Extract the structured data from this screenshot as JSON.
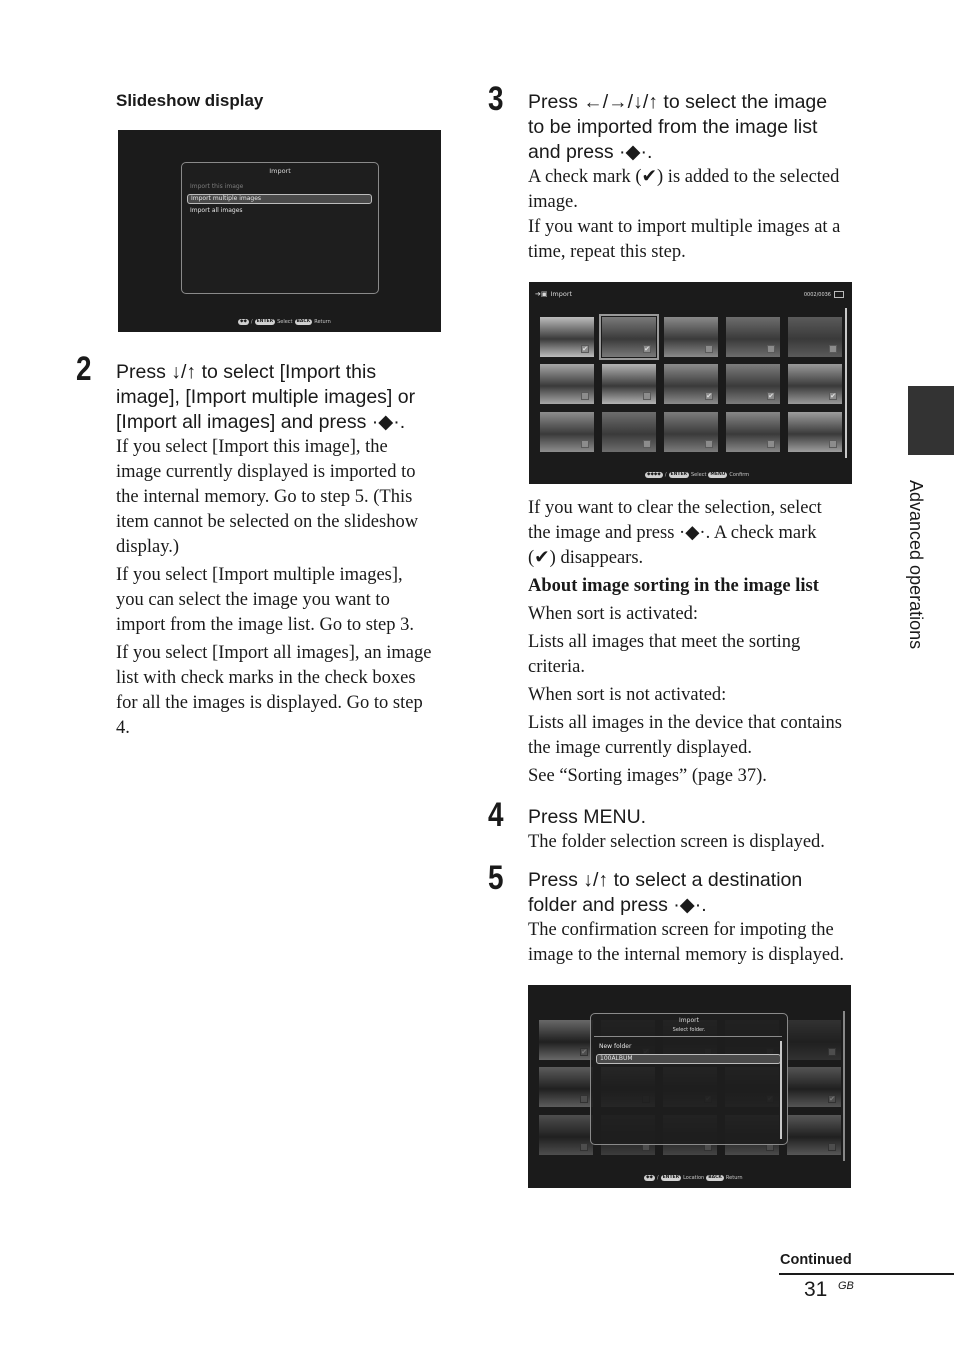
{
  "page": {
    "section_tab": "Advanced operations",
    "continued": "Continued",
    "page_number": "31",
    "page_suffix": "GB"
  },
  "left": {
    "slideshow_title": "Slideshow display",
    "screen1": {
      "title": "Import",
      "items": [
        {
          "label": "Import this image",
          "state": "disabled"
        },
        {
          "label": "Import multiple images",
          "state": "selected"
        },
        {
          "label": "Import all images",
          "state": "normal"
        }
      ],
      "footer": {
        "nav_icon": "up-down-icon",
        "sep": "/",
        "enter_key": "ENTER",
        "enter_action": "Select",
        "back_key": "BACK",
        "back_action": "Return"
      }
    },
    "step2": {
      "number": "2",
      "heading_lines": [
        "Press ↓/↑ to select [Import this",
        "image], [Import multiple images] or",
        "[Import all images] and press ·◆·."
      ],
      "paragraphs": [
        [
          "If you select [Import this image], the",
          "image currently displayed is imported to",
          "the internal memory. Go to step 5. (This",
          "item cannot be selected on the slideshow",
          "display.)"
        ],
        [
          "If you select [Import multiple images],",
          "you can select the image you want to",
          "import from the image list. Go to step 3."
        ],
        [
          "If you select [Import all images], an image",
          "list with check marks in the check boxes",
          "for all the images is displayed. Go to step",
          "4."
        ]
      ]
    }
  },
  "right": {
    "step3": {
      "number": "3",
      "heading_lines": [
        "Press ←/→/↓/↑ to select the image",
        "to be imported from the image list",
        "and press ·◆·."
      ],
      "paragraphs": [
        [
          "A check mark (✔) is added to the selected",
          "image.",
          "If you want to import multiple images at a",
          "time, repeat this step."
        ]
      ]
    },
    "screen2": {
      "title": "Import",
      "counter": "0002/0036",
      "thumbnails": [
        {
          "subject": "lilies",
          "checked": true,
          "tone": "#bdbdbd"
        },
        {
          "subject": "sunflower",
          "checked": true,
          "tone": "#7a7a7a",
          "focused": true
        },
        {
          "subject": "flowers",
          "checked": false,
          "tone": "#8a8a8a"
        },
        {
          "subject": "field-flowers",
          "checked": false,
          "tone": "#6d6d6d"
        },
        {
          "subject": "beach-umbrella",
          "checked": false,
          "tone": "#5a5a5a"
        },
        {
          "subject": "sea",
          "checked": false,
          "tone": "#a8a8a8"
        },
        {
          "subject": "pier",
          "checked": false,
          "tone": "#b4b4b4"
        },
        {
          "subject": "flower-box",
          "checked": true,
          "tone": "#8c8c8c"
        },
        {
          "subject": "lily-of-the-valley",
          "checked": true,
          "tone": "#7d7d7d"
        },
        {
          "subject": "potted-plants",
          "checked": true,
          "tone": "#9a9a9a"
        },
        {
          "subject": "mountains",
          "checked": false,
          "tone": "#8e8e8e"
        },
        {
          "subject": "lake",
          "checked": false,
          "tone": "#6e6e6e"
        },
        {
          "subject": "road",
          "checked": false,
          "tone": "#7c7c7c"
        },
        {
          "subject": "snow-mountain",
          "checked": false,
          "tone": "#888888"
        },
        {
          "subject": "city-harbor",
          "checked": false,
          "tone": "#9e9e9e"
        }
      ],
      "footer": {
        "nav_icon": "four-way-icon",
        "sep": "/",
        "enter_key": "ENTER",
        "enter_action": "Select",
        "menu_key": "MENU",
        "menu_action": "Confirm"
      }
    },
    "after_screen2": [
      [
        "If you want to clear the selection, select",
        "the image and press ·◆·. A check mark",
        "(✔) disappears."
      ]
    ],
    "sorting": {
      "title": "About image sorting in the image list",
      "lines": [
        [
          "When sort is activated:"
        ],
        [
          "Lists all images that meet the sorting",
          "criteria."
        ],
        [
          "When sort is not activated:"
        ],
        [
          "Lists all images in the device that contains",
          "the image currently displayed."
        ],
        [
          "See “Sorting images” (page 37)."
        ]
      ]
    },
    "step4": {
      "number": "4",
      "heading_lines": [
        "Press MENU."
      ],
      "paragraphs": [
        [
          "The folder selection screen is displayed."
        ]
      ]
    },
    "step5": {
      "number": "5",
      "heading_lines": [
        "Press ↓/↑ to select a destination",
        "folder and press ·◆·."
      ],
      "paragraphs": [
        [
          "The confirmation screen for impoting the",
          "image to the internal memory is displayed."
        ]
      ]
    },
    "screen3": {
      "title": "Import",
      "subtitle": "Select folder.",
      "items": [
        {
          "label": "New folder",
          "state": "normal"
        },
        {
          "label": "100ALBUM",
          "state": "selected"
        }
      ],
      "footer": {
        "nav_icon": "up-down-icon",
        "sep": "/",
        "enter_key": "ENTER",
        "enter_action": "Location",
        "back_key": "BACK",
        "back_action": "Return"
      }
    }
  }
}
